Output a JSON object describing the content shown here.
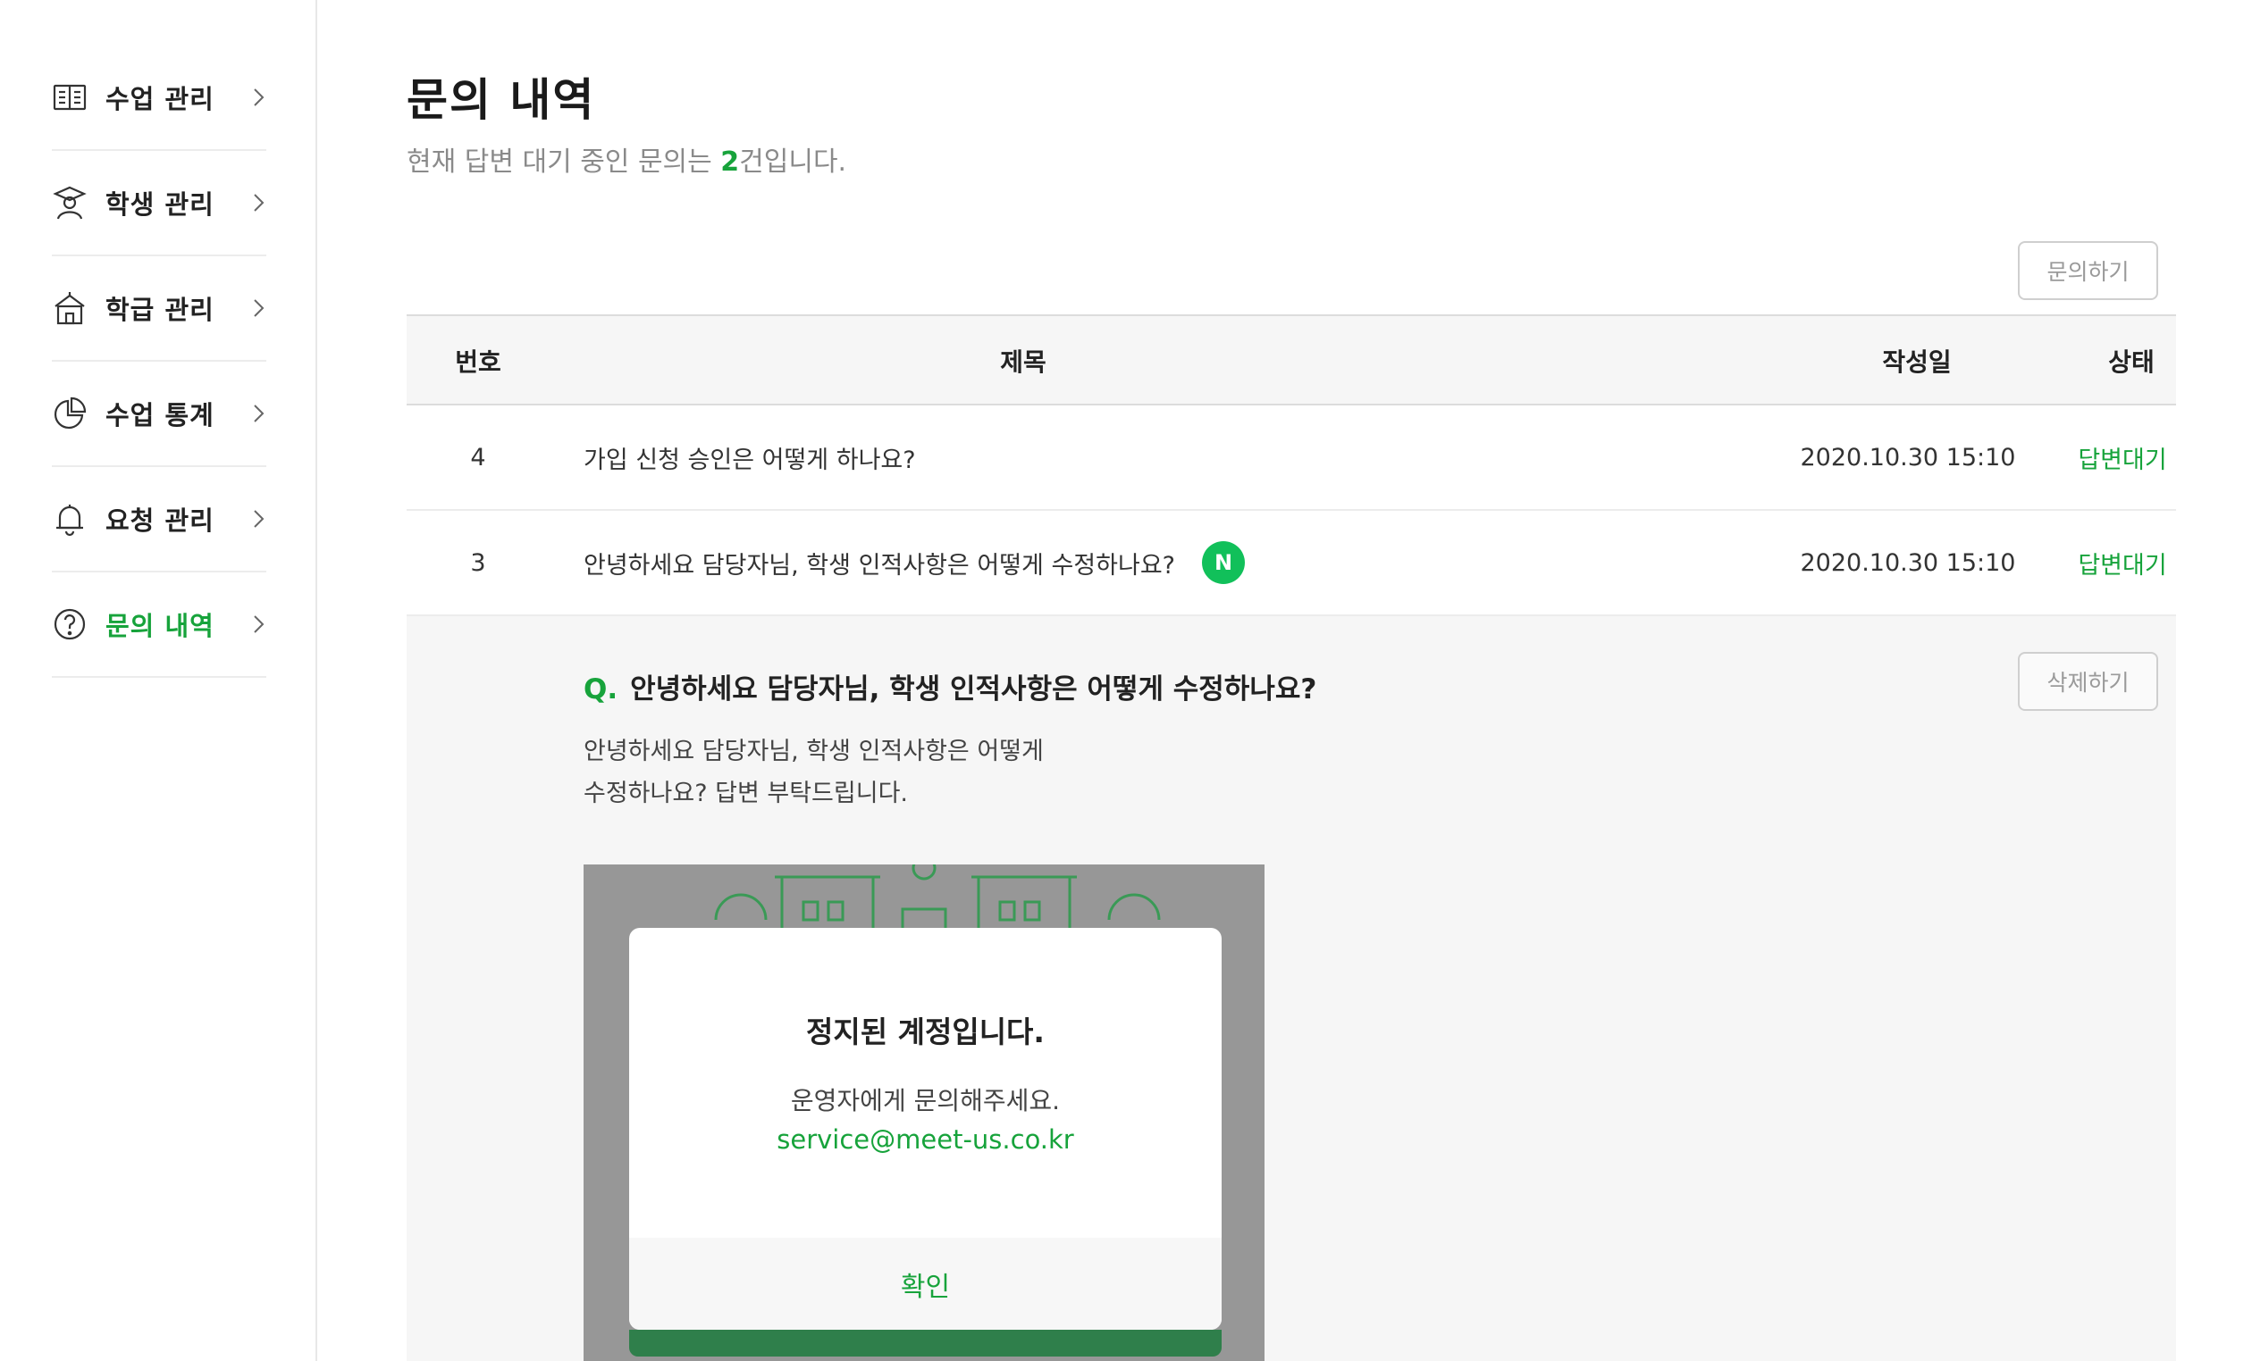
{
  "sidebar": {
    "items": [
      {
        "label": "수업 관리",
        "icon": "book-icon"
      },
      {
        "label": "학생 관리",
        "icon": "student-icon"
      },
      {
        "label": "학급 관리",
        "icon": "school-icon"
      },
      {
        "label": "수업 통계",
        "icon": "pie-chart-icon"
      },
      {
        "label": "요청 관리",
        "icon": "bell-icon"
      },
      {
        "label": "문의 내역",
        "icon": "question-icon",
        "active": true
      }
    ]
  },
  "page": {
    "title": "문의 내역",
    "subtitle_prefix": "현재 답변 대기 중인 문의는 ",
    "pending_count": "2",
    "subtitle_suffix": "건입니다.",
    "inquire_button": "문의하기"
  },
  "table": {
    "headers": {
      "no": "번호",
      "title": "제목",
      "date": "작성일",
      "status": "상태"
    },
    "rows": [
      {
        "no": "4",
        "title": "가입 신청 승인은 어떻게 하나요?",
        "date": "2020.10.30 15:10",
        "status": "답변대기",
        "is_new": false
      },
      {
        "no": "3",
        "title": "안녕하세요 담당자님, 학생 인적사항은 어떻게 수정하나요?",
        "date": "2020.10.30 15:10",
        "status": "답변대기",
        "is_new": true,
        "badge": "N"
      }
    ]
  },
  "detail": {
    "q_mark": "Q.",
    "title": "안녕하세요 담당자님, 학생 인적사항은 어떻게 수정하나요?",
    "delete_button": "삭제하기",
    "body_line1": "안녕하세요 담당자님, 학생 인적사항은 어떻게",
    "body_line2": "수정하나요? 답변 부탁드립니다.",
    "attachment": {
      "modal_title": "정지된 계정입니다.",
      "modal_text": "운영자에게 문의해주세요.",
      "modal_email": "service@meet-us.co.kr",
      "confirm_label": "확인"
    }
  },
  "colors": {
    "accent": "#17a33b",
    "badge": "#11c05a"
  }
}
